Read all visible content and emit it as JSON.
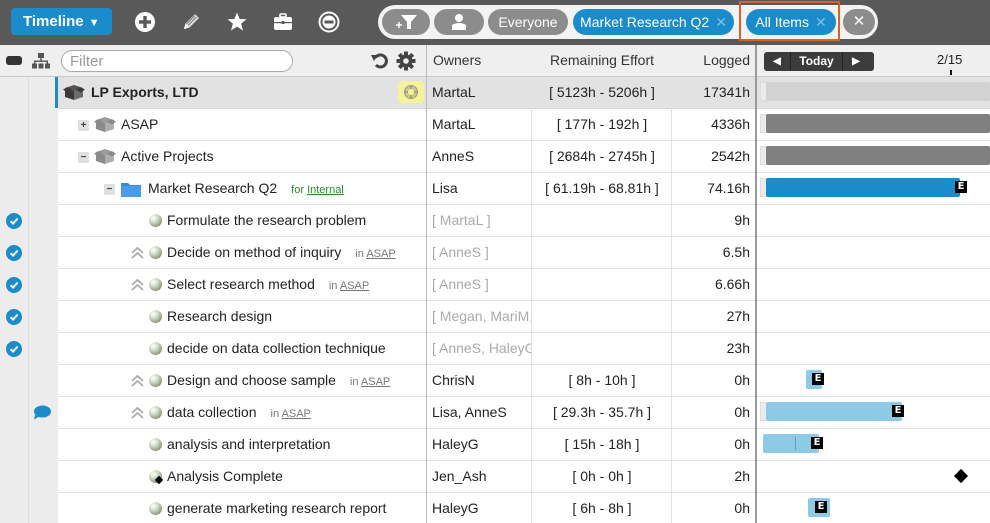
{
  "toolbar": {
    "view_button": "Timeline",
    "view_caret": "▼",
    "icons": [
      "add-icon",
      "edit-pencil-icon",
      "star-icon",
      "briefcase-icon",
      "remove-circle-icon"
    ],
    "filters": {
      "everyone": "Everyone",
      "project": "Market Research Q2",
      "items": "All Items",
      "clear_glyph": "✕",
      "remove_glyph": "✕"
    }
  },
  "header": {
    "filter_placeholder": "Filter",
    "columns": {
      "owners": "Owners",
      "remaining_effort": "Remaining Effort",
      "logged": "Logged"
    },
    "timeline": {
      "prev": "◀",
      "today": "Today",
      "next": "▶",
      "date": "2/15"
    }
  },
  "colors": {
    "accent": "#1b8ccb",
    "summary_bar": "#808080",
    "root_bar": "#d2d2d2",
    "task_bar": "#8ccae6",
    "highlight": "#d9622b"
  },
  "rows": [
    {
      "name": "LP Exports, LTD",
      "type": "root",
      "owner": "MartaL",
      "effort": "[ 5123h - 5206h ]",
      "logged": "17341h"
    },
    {
      "name": "ASAP",
      "type": "package",
      "expander": "+",
      "owner": "MartaL",
      "effort": "[ 177h - 192h ]",
      "logged": "4336h"
    },
    {
      "name": "Active Projects",
      "type": "package",
      "expander": "−",
      "owner": "AnneS",
      "effort": "[ 2684h - 2745h ]",
      "logged": "2542h"
    },
    {
      "name": "Market Research Q2",
      "type": "project",
      "expander": "−",
      "tag_prefix": "for",
      "tag_link": "Internal",
      "owner": "Lisa",
      "effort": "[ 61.19h - 68.81h ]",
      "logged": "74.16h"
    },
    {
      "name": "Formulate the research problem",
      "type": "task",
      "done": true,
      "owner": "[ MartaL ]",
      "effort": "",
      "logged": "9h"
    },
    {
      "name": "Decide on method of inquiry",
      "type": "task",
      "done": true,
      "priority": true,
      "tag_prefix": "in",
      "tag_link": "ASAP",
      "owner": "[ AnneS ]",
      "effort": "",
      "logged": "6.5h"
    },
    {
      "name": "Select research method",
      "type": "task",
      "done": true,
      "priority": true,
      "tag_prefix": "in",
      "tag_link": "ASAP",
      "owner": "[ AnneS ]",
      "effort": "",
      "logged": "6.66h"
    },
    {
      "name": "Research design",
      "type": "task",
      "done": true,
      "owner": "[ Megan, MariM,",
      "effort": "",
      "logged": "27h"
    },
    {
      "name": "decide on data collection technique",
      "type": "task",
      "done": true,
      "owner": "[ AnneS, HaleyG",
      "effort": "",
      "logged": "23h"
    },
    {
      "name": "Design and choose sample",
      "type": "task",
      "priority": true,
      "tag_prefix": "in",
      "tag_link": "ASAP",
      "owner": "ChrisN",
      "effort": "[ 8h - 10h ]",
      "logged": "0h"
    },
    {
      "name": "data collection",
      "type": "task",
      "priority": true,
      "comment": true,
      "tag_prefix": "in",
      "tag_link": "ASAP",
      "owner": "Lisa, AnneS",
      "effort": "[ 29.3h - 35.7h ]",
      "logged": "0h"
    },
    {
      "name": "analysis and interpretation",
      "type": "task",
      "owner": "HaleyG",
      "effort": "[ 15h - 18h ]",
      "logged": "0h"
    },
    {
      "name": "Analysis Complete",
      "type": "milestone",
      "owner": "Jen_Ash",
      "effort": "[ 0h - 0h ]",
      "logged": "2h"
    },
    {
      "name": "generate marketing research report",
      "type": "task",
      "owner": "HaleyG",
      "effort": "[ 6h - 8h ]",
      "logged": "0h"
    }
  ],
  "gantt": {
    "end_marker": "E"
  }
}
